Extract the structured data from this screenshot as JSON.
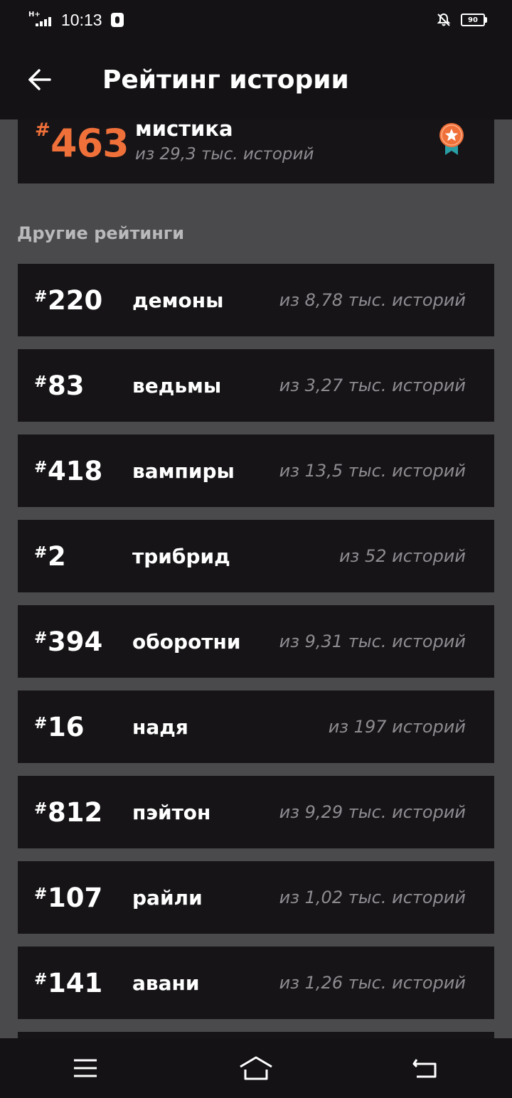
{
  "status_bar": {
    "network": "H+",
    "time": "10:13",
    "battery": "90"
  },
  "app_bar": {
    "title": "Рейтинг истории"
  },
  "main_rating": {
    "hash": "#",
    "rank": "463",
    "category": "мистика",
    "total": "из 29,3 тыс. историй",
    "badge_color": "#f0703a"
  },
  "other_ratings": {
    "title": "Другие рейтинги",
    "items": [
      {
        "hash": "#",
        "rank": "220",
        "category": "демоны",
        "total": "из 8,78 тыс. историй"
      },
      {
        "hash": "#",
        "rank": "83",
        "category": "ведьмы",
        "total": "из 3,27 тыс. историй"
      },
      {
        "hash": "#",
        "rank": "418",
        "category": "вампиры",
        "total": "из 13,5 тыс. историй"
      },
      {
        "hash": "#",
        "rank": "2",
        "category": "трибрид",
        "total": "из 52 историй"
      },
      {
        "hash": "#",
        "rank": "394",
        "category": "оборотни",
        "total": "из 9,31 тыс. историй"
      },
      {
        "hash": "#",
        "rank": "16",
        "category": "надя",
        "total": "из 197 историй"
      },
      {
        "hash": "#",
        "rank": "812",
        "category": "пэйтон",
        "total": "из 9,29 тыс. историй"
      },
      {
        "hash": "#",
        "rank": "107",
        "category": "райли",
        "total": "из 1,02 тыс. историй"
      },
      {
        "hash": "#",
        "rank": "141",
        "category": "авани",
        "total": "из 1,26 тыс. историй"
      },
      {
        "hash": "",
        "rank": "",
        "category": "",
        "total": ""
      }
    ]
  },
  "nav_bar": {
    "menu_icon": "menu-icon",
    "home_icon": "home-icon",
    "back_icon": "back-icon"
  }
}
